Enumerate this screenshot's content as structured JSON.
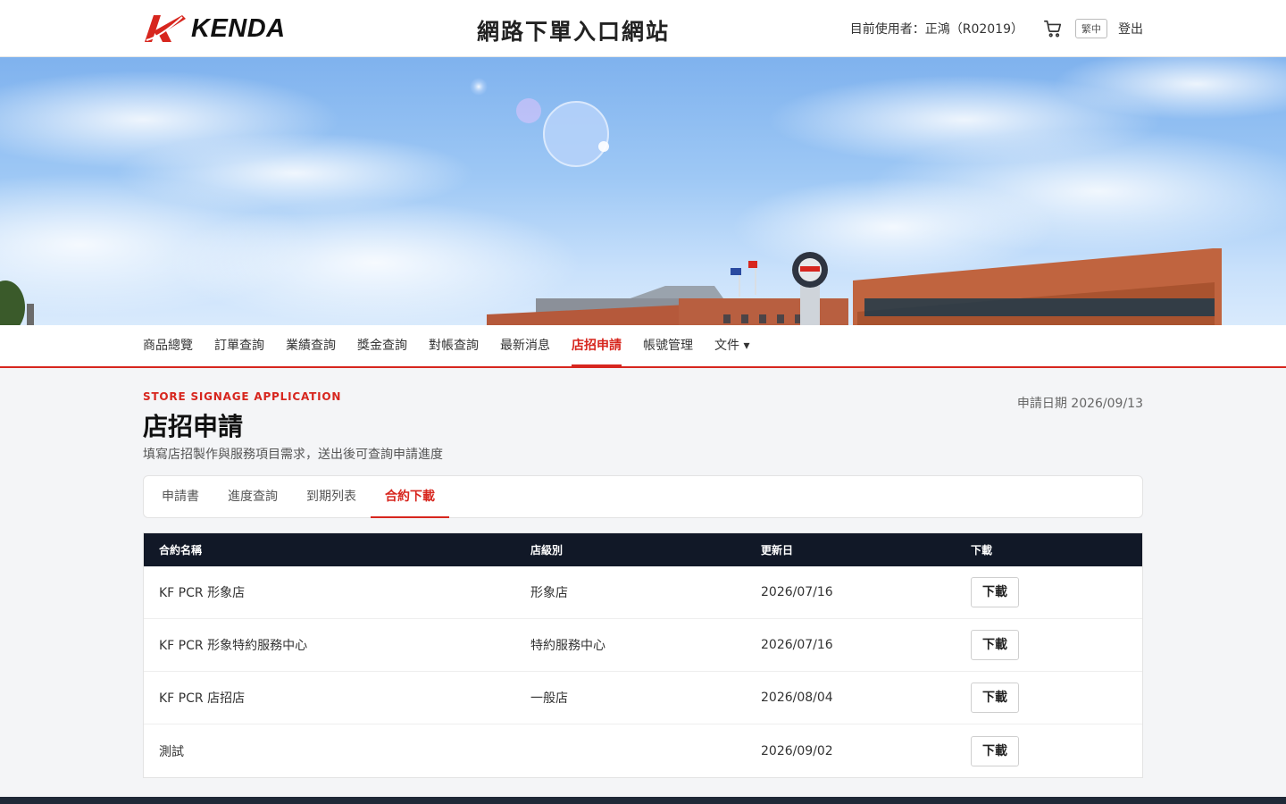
{
  "brand": {
    "logo_text": "KENDA",
    "accent_color": "#d7261e"
  },
  "header": {
    "site_title": "網路下單入口網站",
    "user_text": "目前使用者：正鴻（R02019）",
    "lang_label": "繁中",
    "logout_label": "登出",
    "cart_icon": "cart-icon"
  },
  "nav": {
    "items": [
      {
        "label": "商品總覽"
      },
      {
        "label": "訂單查詢"
      },
      {
        "label": "業績查詢"
      },
      {
        "label": "獎金查詢"
      },
      {
        "label": "對帳查詢"
      },
      {
        "label": "最新消息"
      },
      {
        "label": "店招申請",
        "active": true
      },
      {
        "label": "帳號管理"
      },
      {
        "label": "文件 ▾"
      }
    ]
  },
  "page": {
    "eyebrow": "STORE SIGNAGE APPLICATION",
    "title": "店招申請",
    "subtitle": "填寫店招製作與服務項目需求，送出後可查詢申請進度",
    "apply_date": "申請日期 2026/09/13"
  },
  "tabs": [
    {
      "label": "申請書"
    },
    {
      "label": "進度查詢"
    },
    {
      "label": "到期列表"
    },
    {
      "label": "合約下載",
      "active": true
    }
  ],
  "table": {
    "columns": [
      "合約名稱",
      "店級別",
      "更新日",
      "下載"
    ],
    "download_label": "下載",
    "rows": [
      {
        "name": "KF PCR 形象店",
        "level": "形象店",
        "updated": "2026/07/16"
      },
      {
        "name": "KF PCR 形象特約服務中心",
        "level": "特約服務中心",
        "updated": "2026/07/16"
      },
      {
        "name": "KF PCR 店招店",
        "level": "一般店",
        "updated": "2026/08/04"
      },
      {
        "name": "測試",
        "level": "",
        "updated": "2026/09/02"
      }
    ]
  }
}
